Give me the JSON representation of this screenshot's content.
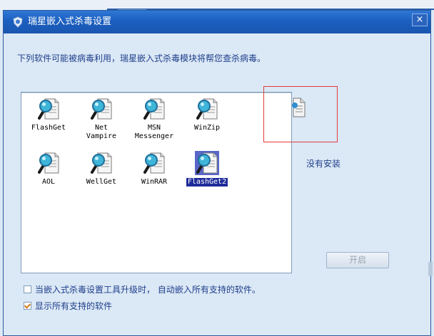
{
  "window": {
    "title": "瑞星嵌入式杀毒设置",
    "close_label": "×"
  },
  "description": "下列软件可能被病毒利用，瑞星嵌入式杀毒模块将帮您查杀病毒。",
  "software": [
    {
      "label": "FlashGet",
      "selected": false
    },
    {
      "label": "Net Vampire",
      "selected": false
    },
    {
      "label": "MSN\nMessenger",
      "selected": false
    },
    {
      "label": "WinZip",
      "selected": false
    },
    {
      "label": "AOL",
      "selected": false
    },
    {
      "label": "WellGet",
      "selected": false
    },
    {
      "label": "WinRAR",
      "selected": false
    },
    {
      "label": "FlashGet2",
      "selected": true
    }
  ],
  "status": {
    "text": "没有安装"
  },
  "start_button": {
    "label": "开启",
    "enabled": false
  },
  "options": {
    "auto_embed": {
      "label": "当嵌入式杀毒设置工具升级时， 自动嵌入所有支持的软件。",
      "checked": false
    },
    "show_all": {
      "label": "显示所有支持的软件",
      "checked": true
    }
  },
  "colors": {
    "title_bar": "#1b5fc0",
    "background": "#dbe8f5",
    "selection": "#1f2c9a",
    "highlight_box": "#e23b3b"
  },
  "icons": {
    "title": "shield-icon",
    "software_item": "magnifier-document-icon",
    "status": "document-icon"
  }
}
